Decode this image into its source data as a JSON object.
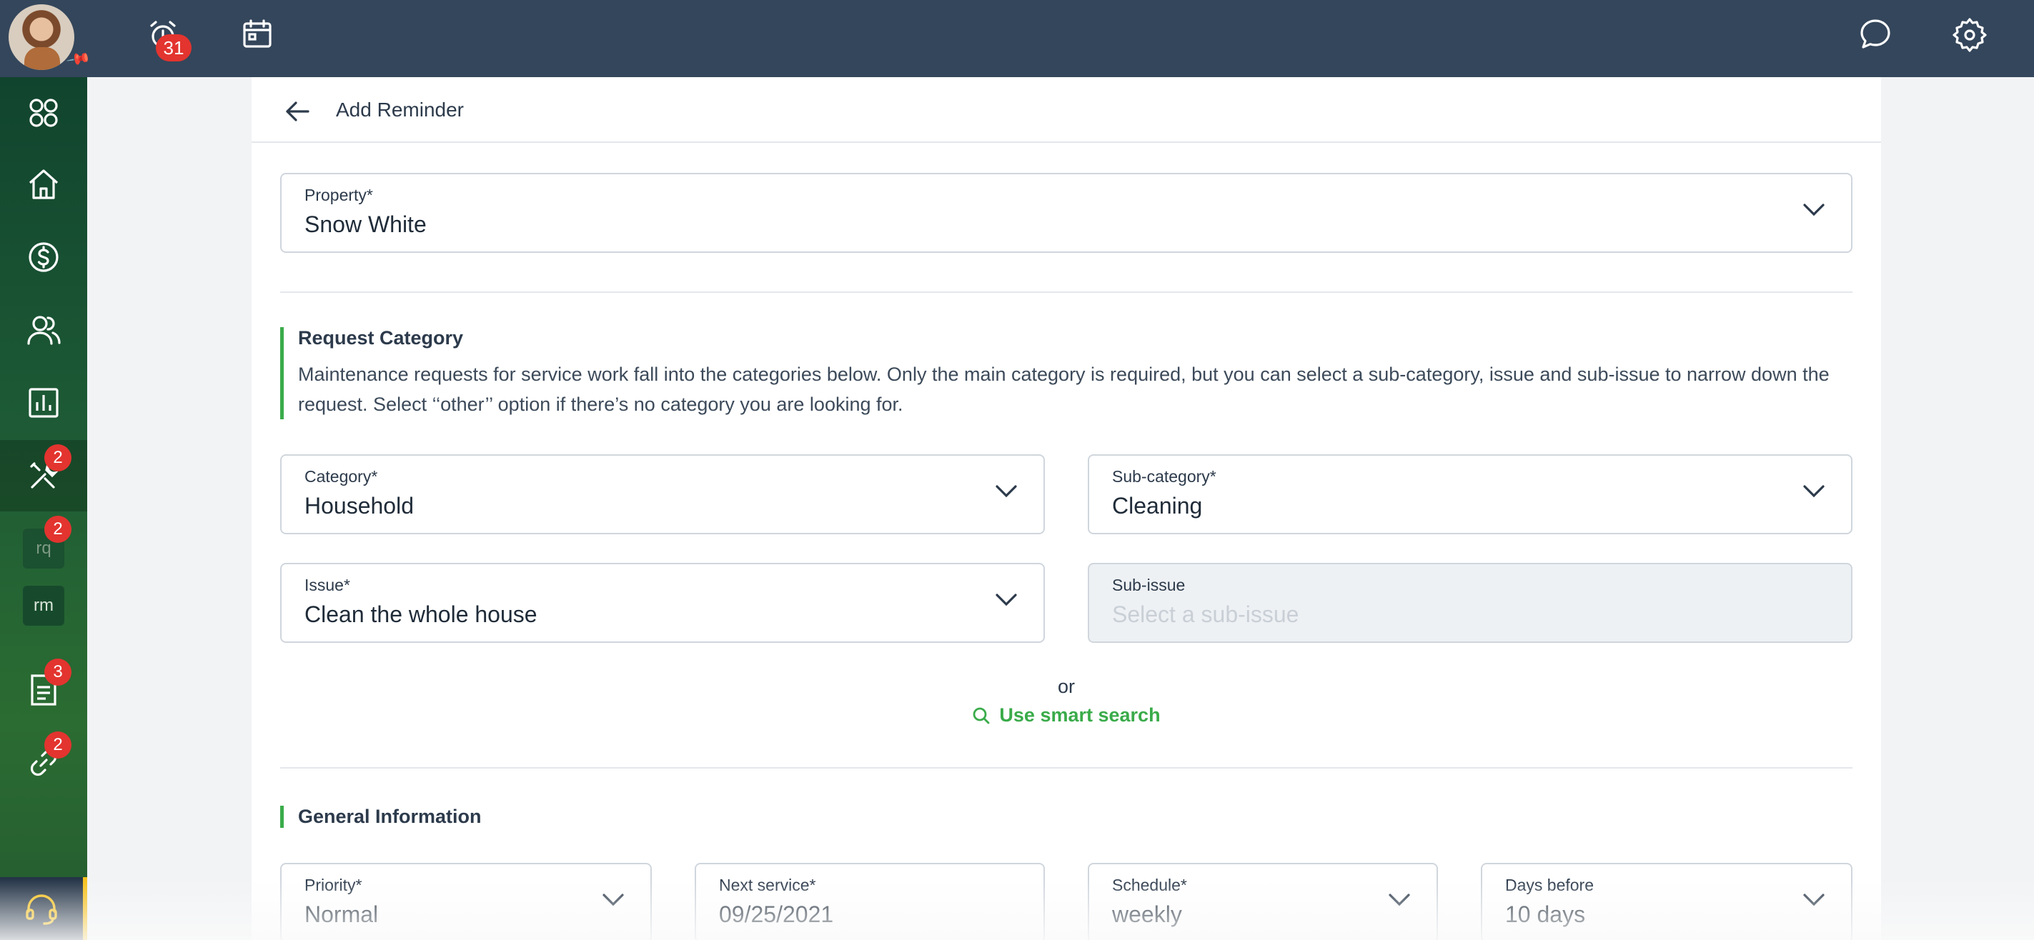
{
  "topbar": {
    "alarm_badge": "31"
  },
  "sidebar": {
    "items": [
      {
        "name": "dashboard",
        "badge": ""
      },
      {
        "name": "home",
        "badge": ""
      },
      {
        "name": "finance",
        "badge": ""
      },
      {
        "name": "people",
        "badge": ""
      },
      {
        "name": "reports",
        "badge": ""
      },
      {
        "name": "maintenance",
        "badge": "2"
      },
      {
        "name": "rq",
        "label": "rq",
        "badge": "2"
      },
      {
        "name": "rm",
        "label": "rm",
        "badge": ""
      },
      {
        "name": "documents",
        "badge": "3"
      },
      {
        "name": "links",
        "badge": "2"
      }
    ]
  },
  "header": {
    "title": "Add Reminder"
  },
  "form": {
    "property": {
      "label": "Property*",
      "value": "Snow White"
    },
    "request_category": {
      "title": "Request Category",
      "description": "Maintenance requests for service work fall into the categories below. Only the main category is required, but you can select a sub-category, issue and sub-issue to narrow down the request. Select ‘‘other’’ option if there’s no category you are looking for."
    },
    "category": {
      "label": "Category*",
      "value": "Household"
    },
    "sub_category": {
      "label": "Sub-category*",
      "value": "Cleaning"
    },
    "issue": {
      "label": "Issue*",
      "value": "Clean the whole house"
    },
    "sub_issue": {
      "label": "Sub-issue",
      "placeholder": "Select a sub-issue"
    },
    "or_text": "or",
    "smart_search": "Use smart search",
    "general_information": {
      "title": "General Information"
    },
    "priority": {
      "label": "Priority*",
      "value": "Normal"
    },
    "next_service": {
      "label": "Next service*",
      "value": "09/25/2021"
    },
    "schedule": {
      "label": "Schedule*",
      "value": "weekly"
    },
    "days_before": {
      "label": "Days before",
      "value": "10 days"
    }
  },
  "colors": {
    "topbar": "#34465b",
    "sidebar": "#1d5a35",
    "accent_green": "#3aab4a",
    "badge_red": "#e3342f",
    "support_accent": "#f5c01a"
  }
}
